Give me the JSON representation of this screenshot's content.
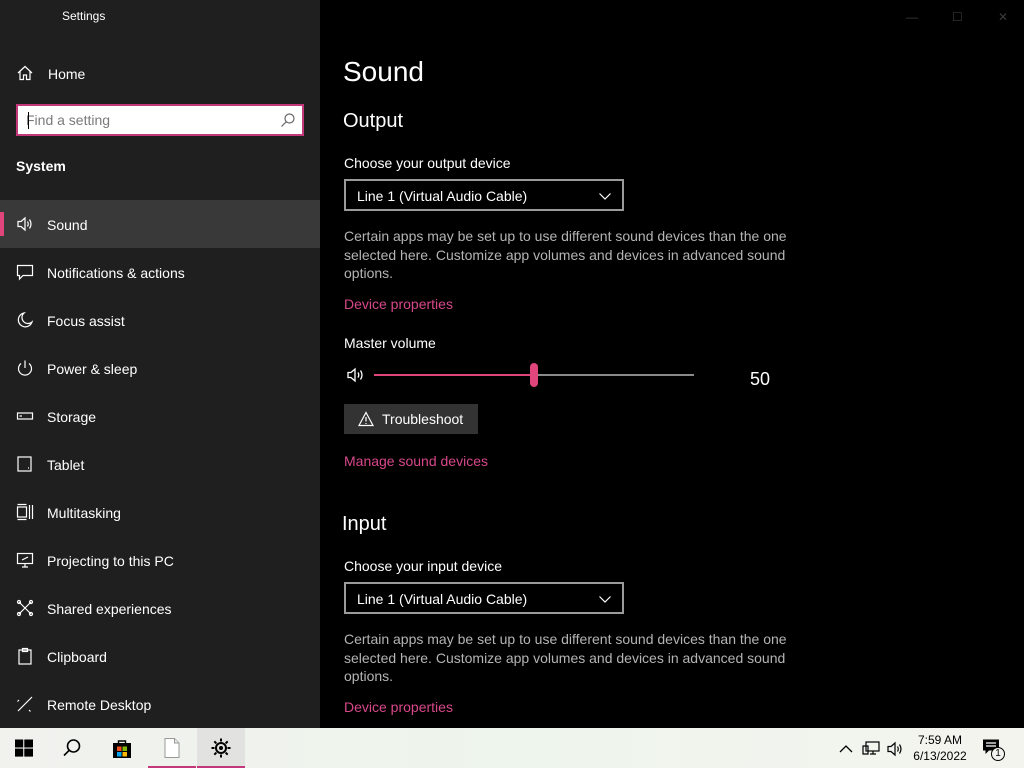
{
  "window": {
    "title": "Settings",
    "minimize": "—",
    "maximize": "☐",
    "close": "✕"
  },
  "sidebar": {
    "home": "Home",
    "search_placeholder": "Find a setting",
    "section": "System",
    "items": [
      {
        "label": "Sound",
        "icon": "speaker-icon",
        "active": true
      },
      {
        "label": "Notifications & actions",
        "icon": "notification-icon"
      },
      {
        "label": "Focus assist",
        "icon": "moon-icon"
      },
      {
        "label": "Power & sleep",
        "icon": "power-icon"
      },
      {
        "label": "Storage",
        "icon": "storage-icon"
      },
      {
        "label": "Tablet",
        "icon": "tablet-icon"
      },
      {
        "label": "Multitasking",
        "icon": "multitasking-icon"
      },
      {
        "label": "Projecting to this PC",
        "icon": "projecting-icon"
      },
      {
        "label": "Shared experiences",
        "icon": "shared-experiences-icon"
      },
      {
        "label": "Clipboard",
        "icon": "clipboard-icon"
      },
      {
        "label": "Remote Desktop",
        "icon": "remote-desktop-icon"
      }
    ]
  },
  "main": {
    "title": "Sound",
    "output": {
      "heading": "Output",
      "device_label": "Choose your output device",
      "device_value": "Line 1 (Virtual Audio Cable)",
      "description": "Certain apps may be set up to use different sound devices than the one selected here. Customize app volumes and devices in advanced sound options.",
      "device_properties": "Device properties",
      "volume_label": "Master volume",
      "volume_value": "50",
      "volume_fraction": 0.5,
      "troubleshoot": "Troubleshoot",
      "manage": "Manage sound devices"
    },
    "input": {
      "heading": "Input",
      "device_label": "Choose your input device",
      "device_value": "Line 1 (Virtual Audio Cable)",
      "description": "Certain apps may be set up to use different sound devices than the one selected here. Customize app volumes and devices in advanced sound options.",
      "device_properties": "Device properties"
    }
  },
  "taskbar": {
    "time": "7:59 AM",
    "date": "6/13/2022",
    "notification_count": "1"
  },
  "colors": {
    "accent": "#e0457b",
    "link": "#d7488a",
    "sidebar_bg": "#1f1f1f"
  }
}
